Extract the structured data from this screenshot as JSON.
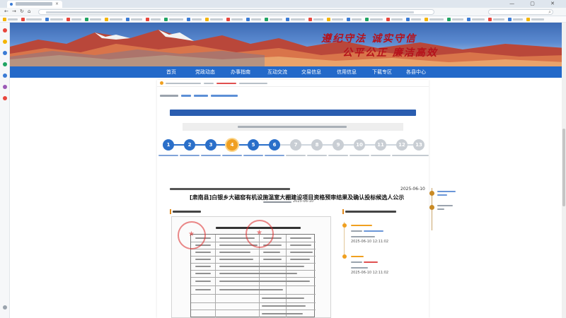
{
  "browser": {
    "window_controls": "— ▢ ✕",
    "tab_close": "×",
    "nav_icons": [
      "←",
      "→",
      "↻",
      "⌂"
    ],
    "search_glyph": "⌕"
  },
  "header": {
    "slogan_line1": "遵纪守法  诚实守信",
    "slogan_line2": "公平公正  廉洁高效"
  },
  "nav": {
    "items": [
      "首页",
      "党政动态",
      "办事指南",
      "互动交流",
      "交易信息",
      "信用信息",
      "下载专区",
      "各县中心"
    ]
  },
  "notice": {
    "steps": [
      {
        "num": "1",
        "status": "done"
      },
      {
        "num": "2",
        "status": "done"
      },
      {
        "num": "3",
        "status": "done"
      },
      {
        "num": "4",
        "status": "current"
      },
      {
        "num": "5",
        "status": "done"
      },
      {
        "num": "6",
        "status": "done"
      },
      {
        "num": "7",
        "status": "pending"
      },
      {
        "num": "8",
        "status": "pending"
      },
      {
        "num": "9",
        "status": "pending"
      },
      {
        "num": "10",
        "status": "pending"
      },
      {
        "num": "11",
        "status": "pending"
      },
      {
        "num": "12",
        "status": "pending"
      },
      {
        "num": "13",
        "status": "pending"
      }
    ],
    "doc_date": "2025-06-10",
    "doc_title": "[肃南县]白银乡大磁窑有机设施温室大棚建设项目资格预审结果及确认投标候选人公示",
    "doc_sub_date": "2025-06-10",
    "flow_dates": [
      "2025-06-10 12:11:02",
      "2025-06-10 12:11:02"
    ]
  },
  "colors": {
    "nav": "#2369c9",
    "step_done": "#2a6fc9",
    "step_current": "#f0a020",
    "step_pending": "#c9ced4",
    "slogan": "#b5121b"
  }
}
